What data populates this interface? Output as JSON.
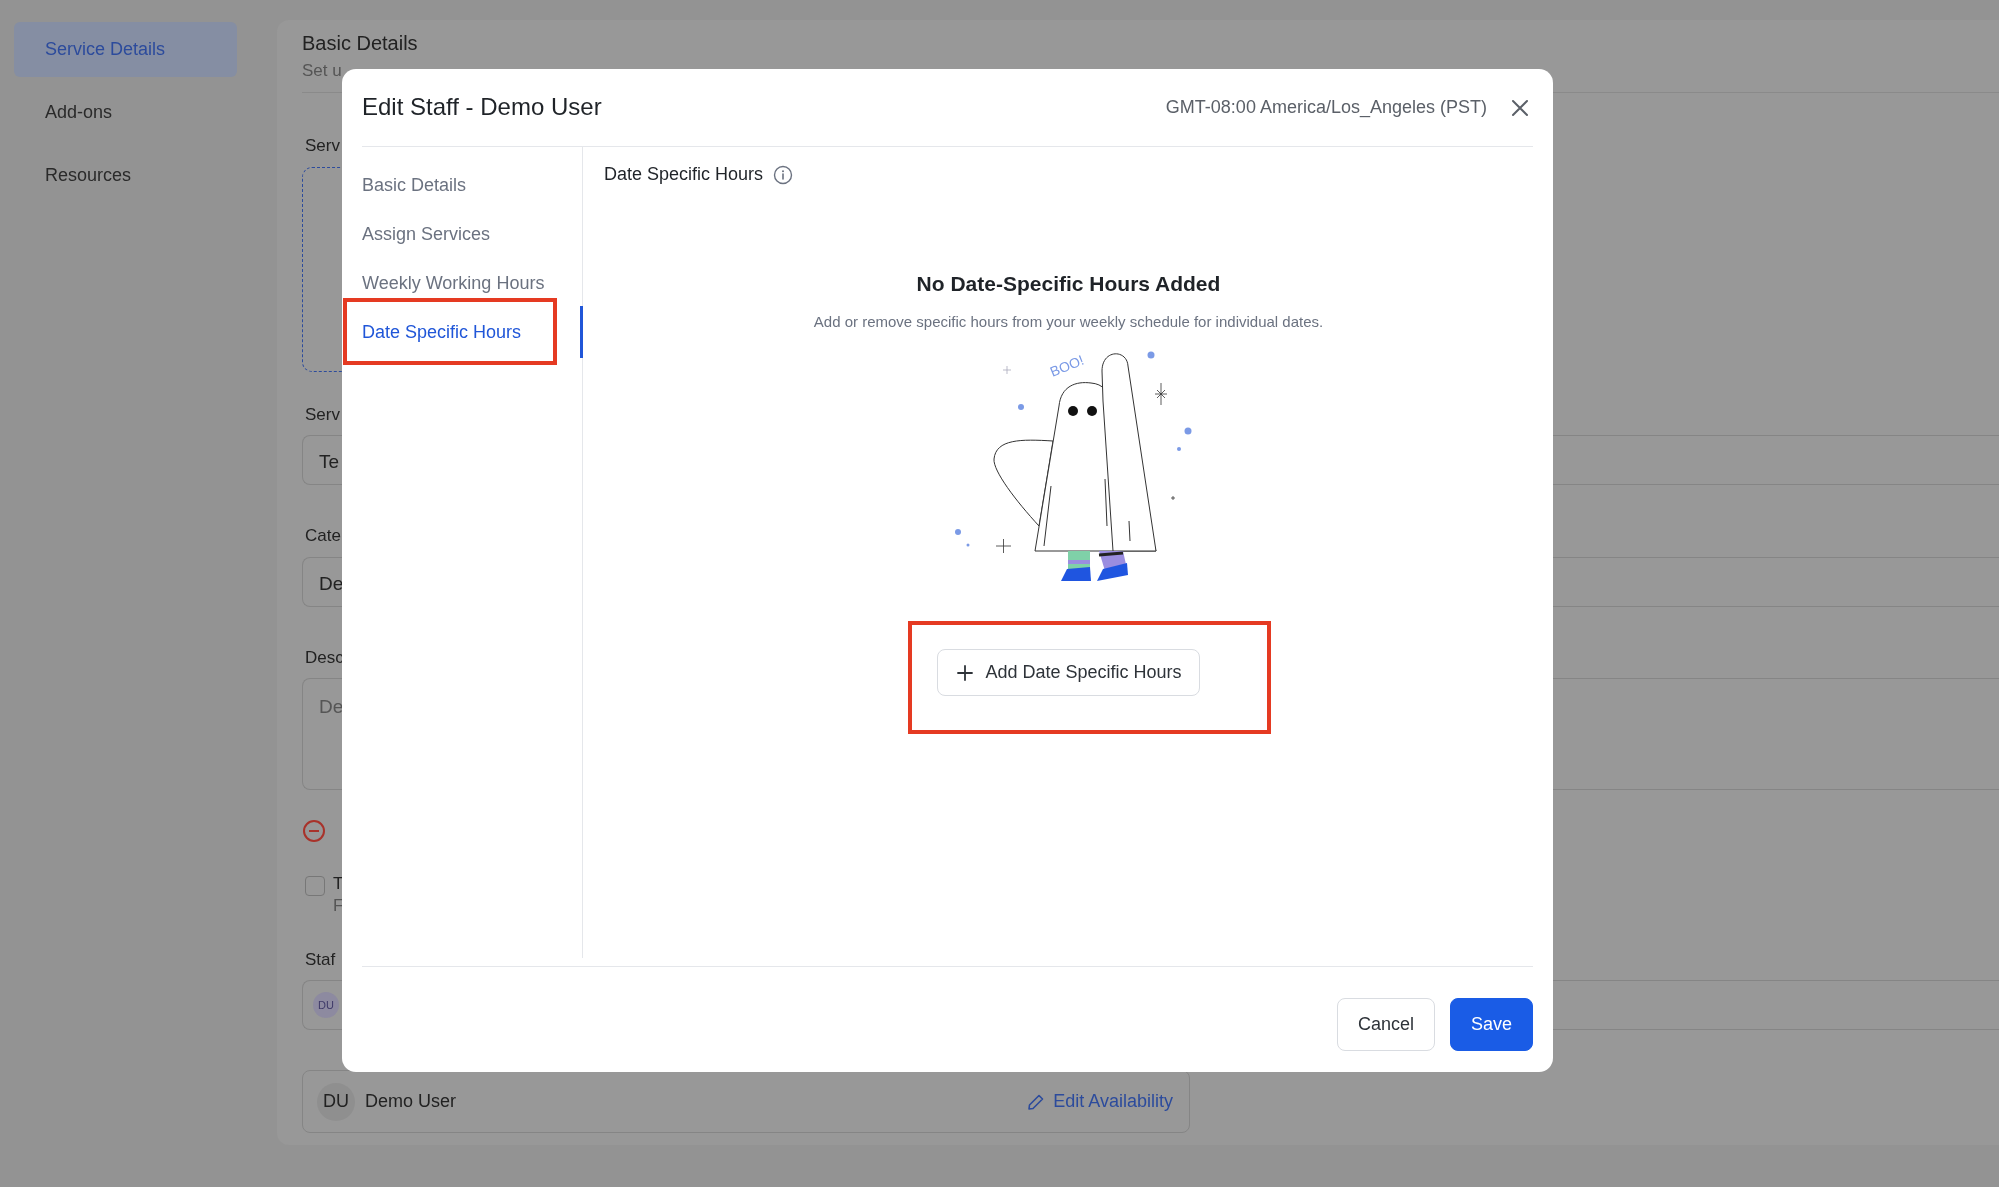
{
  "sidebar": {
    "items": [
      {
        "label": "Service Details",
        "selected": true
      },
      {
        "label": "Add-ons",
        "selected": false
      },
      {
        "label": "Resources",
        "selected": false
      }
    ]
  },
  "form": {
    "title": "Basic Details",
    "subtitle": "Set u",
    "fields": [
      {
        "kind": "upload",
        "label": "Serv"
      },
      {
        "kind": "input",
        "label": "Serv",
        "value": "Te"
      },
      {
        "kind": "input",
        "label": "Cate",
        "value": "De"
      },
      {
        "kind": "textarea",
        "label": "Desc",
        "placeholder": "De"
      },
      {
        "kind": "remove"
      },
      {
        "kind": "checkbox",
        "checked": false,
        "label": "T",
        "hint": "F"
      },
      {
        "kind": "staff",
        "label": "Staf",
        "avatar": "DU"
      }
    ],
    "staff_row": {
      "initials": "DU",
      "name": "Demo User",
      "action": "Edit Availability"
    }
  },
  "modal": {
    "title": "Edit Staff - Demo User",
    "timezone": "GMT-08:00 America/Los_Angeles (PST)",
    "nav": [
      {
        "label": "Basic Details",
        "selected": false,
        "highlighted": false
      },
      {
        "label": "Assign Services",
        "selected": false,
        "highlighted": false
      },
      {
        "label": "Weekly Working Hours",
        "selected": false,
        "highlighted": false
      },
      {
        "label": "Date Specific Hours",
        "selected": true,
        "highlighted": true
      }
    ],
    "section_title": "Date Specific Hours",
    "empty_state": {
      "title": "No Date-Specific Hours Added",
      "description": "Add or remove specific hours from your weekly schedule for individual dates.",
      "illustration_text": "BOO!"
    },
    "add_button": {
      "label": "Add Date Specific Hours",
      "highlighted": true
    },
    "footer_buttons": [
      {
        "label": "Cancel",
        "kind": "secondary"
      },
      {
        "label": "Save",
        "kind": "primary"
      }
    ]
  }
}
